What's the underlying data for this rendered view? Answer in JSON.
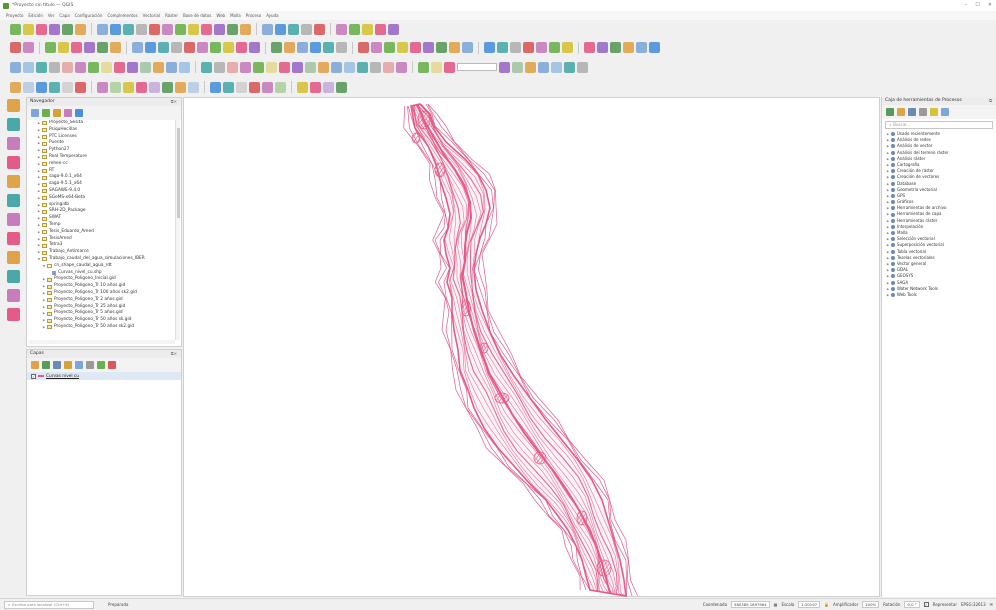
{
  "window": {
    "title": "*Proyecto sin título — QGIS",
    "controls": [
      "–",
      "☐",
      "✕"
    ]
  },
  "menu": [
    "Proyecto",
    "Edición",
    "Ver",
    "Capa",
    "Configuración",
    "Complementos",
    "Vectorial",
    "Ráster",
    "Base de datos",
    "Web",
    "Malla",
    "Proceso",
    "Ayuda"
  ],
  "colors": {
    "contour": "#e35b86",
    "accent": "#589632",
    "selection": "#dfe9f5"
  },
  "browser": {
    "title": "Navegador",
    "items": [
      {
        "label": "Proyecto_Sesita",
        "indent": 1,
        "kind": "folder"
      },
      {
        "label": "PsiquHecillas",
        "indent": 1,
        "kind": "folder"
      },
      {
        "label": "PTC Licenses",
        "indent": 1,
        "kind": "folder"
      },
      {
        "label": "Puente",
        "indent": 1,
        "kind": "folder"
      },
      {
        "label": "Python27",
        "indent": 1,
        "kind": "folder"
      },
      {
        "label": "Real Temperature",
        "indent": 1,
        "kind": "folder"
      },
      {
        "label": "rehen-cc",
        "indent": 1,
        "kind": "folder"
      },
      {
        "label": "RT",
        "indent": 1,
        "kind": "folder"
      },
      {
        "label": "saga-9.0.1_x64",
        "indent": 1,
        "kind": "folder"
      },
      {
        "label": "saga-9.5.1_x64",
        "indent": 1,
        "kind": "folder"
      },
      {
        "label": "SAGAWE-9.4.0",
        "indent": 1,
        "kind": "folder"
      },
      {
        "label": "SGeMS-x64-Beta",
        "indent": 1,
        "kind": "folder"
      },
      {
        "label": "springidb",
        "indent": 1,
        "kind": "folder"
      },
      {
        "label": "SRH-2D_Package",
        "indent": 1,
        "kind": "folder"
      },
      {
        "label": "SWAT",
        "indent": 1,
        "kind": "folder"
      },
      {
        "label": "Temp",
        "indent": 1,
        "kind": "folder"
      },
      {
        "label": "Tesis_Eduardo_Amed",
        "indent": 1,
        "kind": "folder"
      },
      {
        "label": "TesisAmed",
        "indent": 1,
        "kind": "folder"
      },
      {
        "label": "Tetra3",
        "indent": 1,
        "kind": "folder"
      },
      {
        "label": "Trabajo_Antimarce",
        "indent": 1,
        "kind": "folder"
      },
      {
        "label": "Trabajo_caudal_del_agua_simulaciones_IBER",
        "indent": 1,
        "kind": "folder-open"
      },
      {
        "label": "cn_shape_caudal_agua_rdt",
        "indent": 2,
        "kind": "folder-open"
      },
      {
        "label": "Curvas_nivel_cu.shp",
        "indent": 3,
        "kind": "shape"
      },
      {
        "label": "Proyecto_Poligono_Inicial.gid",
        "indent": 2,
        "kind": "folder"
      },
      {
        "label": "Proyecto_Poligono_Tr 10 años.gid",
        "indent": 2,
        "kind": "folder"
      },
      {
        "label": "Proyecto_Poligono_Tr 100 años sk2.gid",
        "indent": 2,
        "kind": "folder"
      },
      {
        "label": "Proyecto_Poligono_Tr 2 años.gid",
        "indent": 2,
        "kind": "folder"
      },
      {
        "label": "Proyecto_Poligono_Tr 25 años.gid",
        "indent": 2,
        "kind": "folder"
      },
      {
        "label": "Proyecto_Poligono_Tr 5 años.gid",
        "indent": 2,
        "kind": "folder"
      },
      {
        "label": "Proyecto_Poligono_Tr 50 años sk.gid",
        "indent": 2,
        "kind": "folder"
      },
      {
        "label": "Proyecto_Poligono_Tr 50 años sk2.gid",
        "indent": 2,
        "kind": "folder"
      }
    ]
  },
  "layers": {
    "title": "Capas",
    "items": [
      {
        "label": "Curvas nivel cu",
        "checked": true
      }
    ]
  },
  "processing": {
    "title": "Caja de herramientas de Procesos",
    "search_placeholder": "Buscar...",
    "items": [
      "Usado recientemente",
      "Análisis de redes",
      "Análisis de vector",
      "Análisis del terreno ráster",
      "Análisis ráster",
      "Cartografía",
      "Creación de ráster",
      "Creación de vectores",
      "Database",
      "Geometría vectorial",
      "GPS",
      "Gráficos",
      "Herramientas de archivo",
      "Herramientas de capa",
      "Herramientas ráster",
      "Interpolación",
      "Malla",
      "Selección vectorial",
      "Superposición vectorial",
      "Tabla vectorial",
      "Teselas vectoriales",
      "Vector general",
      "GDAL",
      "GEOSYS",
      "SAGA",
      "Water Network Tools",
      "Web Tools"
    ]
  },
  "status": {
    "locator_placeholder": "Escriba para localizar (Ctrl+K)",
    "message": "Preparada",
    "coordinate_label": "Coordenada",
    "coordinate": "580389,1897964",
    "scale_label": "Escala",
    "scale": "1:20197",
    "magnifier_label": "Amplificador",
    "magnifier": "100%",
    "rotation_label": "Rotación",
    "rotation": "0,0 °",
    "render_label": "Representar",
    "crs": "EPSG:32613"
  }
}
